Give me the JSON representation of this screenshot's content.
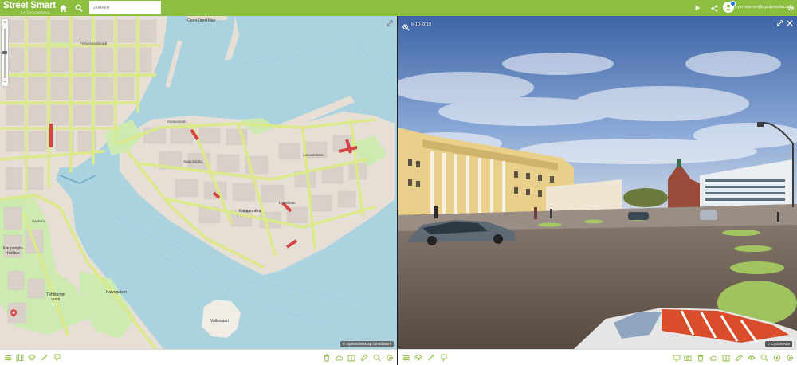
{
  "app": {
    "logo_text": "Street Smart",
    "logo_subtitle": "BY CYCLOMEDIA",
    "brand_color": "#8cbe3f"
  },
  "header": {
    "search_placeholder": "Zoeken",
    "user_email": "f.verhoeven@cyclomedia.com",
    "icons": [
      "home-icon",
      "search-icon",
      "play-icon",
      "share-icon",
      "avatar-icon",
      "settings-icon"
    ]
  },
  "map": {
    "attribution": "© OpenStreetMap contributors",
    "labels": {
      "top_pier": "OpenStreetMap",
      "island": "Valkosaari",
      "park": "Tähtitornin\nvuori",
      "district": "Katajanokka",
      "pin_label": "Kaupungin-\nhallitus",
      "site": "Kaivopuisto"
    },
    "street_labels": [
      "Pohjoisesplanadi",
      "Kanavakatu",
      "Satamakatu",
      "Laivastokatu",
      "Luotsikatu",
      "Vyökatu"
    ]
  },
  "panorama": {
    "date": "6-10-2019",
    "attribution": "© Cyclomedia",
    "icons": [
      "zoom-icon",
      "expand-icon",
      "close-icon"
    ]
  },
  "toolbar_left": {
    "icons": [
      "menu-icon",
      "map-icon",
      "layers-icon",
      "measure-icon",
      "marker-icon",
      "bin-icon",
      "cloud-icon",
      "book-icon",
      "ruler-icon",
      "zoom-in-icon",
      "settings-icon"
    ]
  },
  "toolbar_right": {
    "icons": [
      "menu-icon",
      "layers-icon",
      "measure-icon",
      "marker-icon",
      "screen-icon",
      "camera-icon",
      "bin-icon",
      "cloud-icon",
      "book-icon",
      "ruler-icon",
      "eye-icon",
      "zoom-in-icon",
      "compass-icon",
      "settings-icon"
    ]
  }
}
